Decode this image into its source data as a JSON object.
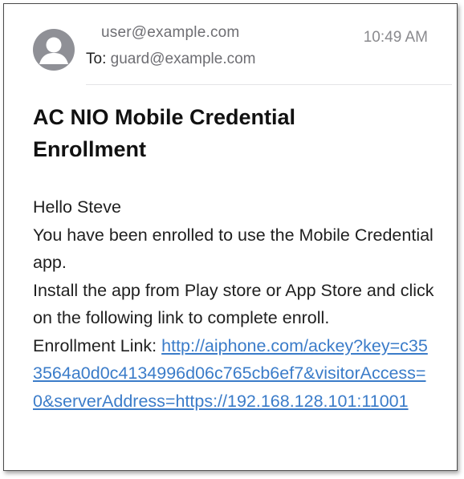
{
  "email": {
    "from": "user@example.com",
    "to_label": "To:",
    "to": "guard@example.com",
    "time": "10:49 AM",
    "subject": "AC NIO Mobile Credential Enrollment",
    "greeting": "Hello Steve",
    "line1": "You have been enrolled to use the Mobile Credential app.",
    "line2": "Install the app from Play store or App Store and click on the following link to complete enroll.",
    "link_label": "Enrollment Link:",
    "link": "http://aiphone.com/ackey?key=c353564a0d0c4134996d06c765cb6ef7&visitorAccess=0&serverAddress=https://192.168.128.101:11001"
  },
  "colors": {
    "link": "#3b7cc9",
    "avatar": "#8f9096",
    "secondary_text": "#6e6e73"
  },
  "icons": {
    "avatar": "person-avatar-icon"
  }
}
